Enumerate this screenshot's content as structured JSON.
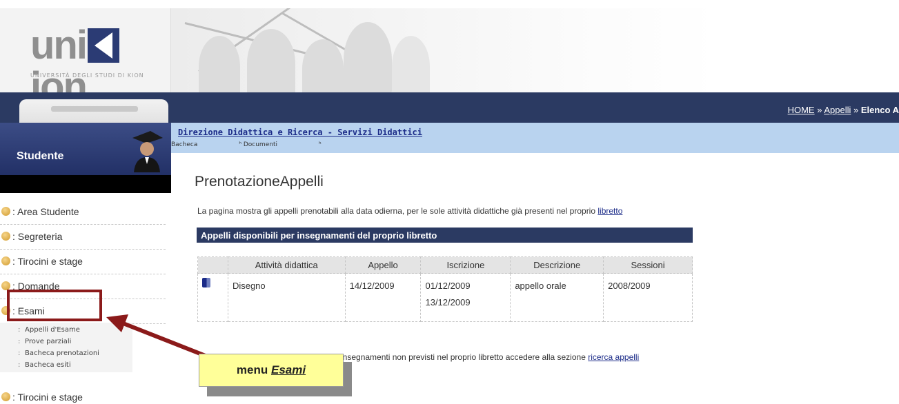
{
  "header": {
    "logo_text_left": "uni",
    "logo_text_right": "ion",
    "logo_subtitle": "UNIVERSITÀ DEGLI STUDI DI KION"
  },
  "breadcrumb": {
    "home": "HOME",
    "sep1": " » ",
    "appelli": "Appelli",
    "sep2": " » ",
    "current": "Elenco A"
  },
  "sidebar": {
    "role_label": "Studente",
    "items": [
      {
        "label": ": Area Studente"
      },
      {
        "label": ": Segreteria"
      },
      {
        "label": ": Tirocini e stage"
      },
      {
        "label": ": Domande"
      },
      {
        "label": ": Esami"
      }
    ],
    "submenu": [
      "Appelli d'Esame",
      "Prove parziali",
      "Bacheca prenotazioni",
      "Bacheca esiti"
    ],
    "last_item": ": Tirocini e stage"
  },
  "infobar": {
    "direction_link": "Direzione Didattica e Ricerca - Servizi Didattici",
    "tab1": "Bacheca",
    "tab2": "Documenti"
  },
  "main": {
    "title": "PrenotazioneAppelli",
    "intro_text": "La pagina mostra gli appelli prenotabili alla data odierna, per le sole attività didattiche già presenti nel proprio ",
    "intro_link": "libretto",
    "table_title": "Appelli disponibili per insegnamenti del proprio libretto",
    "columns": [
      "Attività didattica",
      "Appello",
      "Iscrizione",
      "Descrizione",
      "Sessioni"
    ],
    "rows": [
      {
        "attivita": "Disegno",
        "appello": "14/12/2009",
        "iscrizione_da": "01/12/2009",
        "iscrizione_a": "13/12/2009",
        "descrizione": "appello orale",
        "sessioni": "2008/2009"
      }
    ],
    "bottom_text": "insegnamenti non previsti nel proprio libretto accedere alla sezione ",
    "bottom_link": "ricerca appelli"
  },
  "annotation": {
    "callout_prefix": "menu ",
    "callout_emph": "Esami"
  },
  "colors": {
    "navy": "#2b3a62",
    "highlight_red": "#8b1a1a",
    "callout_yellow": "#ffff99",
    "infobar_blue": "#b9d3ef"
  }
}
